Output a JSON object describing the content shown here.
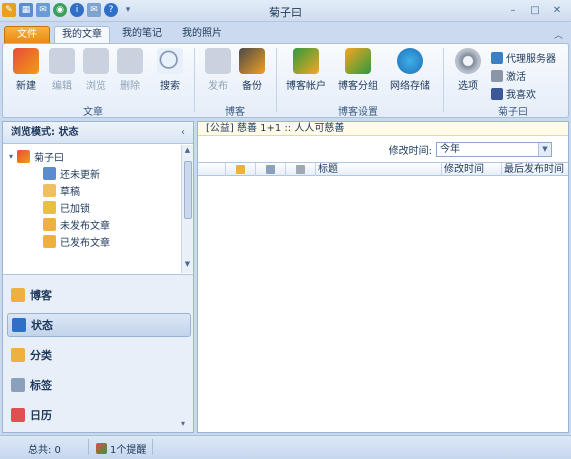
{
  "window": {
    "title": "菊子曰"
  },
  "tabs": {
    "file": "文件",
    "articles": "我的文章",
    "notes": "我的笔记",
    "photos": "我的照片"
  },
  "ribbon": {
    "new": "新建",
    "edit": "编辑",
    "browse": "浏览",
    "delete": "删除",
    "search": "搜索",
    "publish": "发布",
    "backup": "备份",
    "blog_account": "博客帐户",
    "blog_group": "博客分组",
    "net_storage": "网络存储",
    "options": "选项",
    "proxy": "代理服务器",
    "activate": "激活",
    "like": "我喜欢",
    "group_article": "文章",
    "group_blog": "博客",
    "group_blog_settings": "博客设置",
    "group_app": "菊子曰"
  },
  "left": {
    "header": "浏览模式: 状态",
    "tree": {
      "root": "菊子曰",
      "items": [
        "还未更新",
        "草稿",
        "已加锁",
        "未发布文章",
        "已发布文章"
      ]
    },
    "nav": [
      "博客",
      "状态",
      "分类",
      "标签",
      "日历"
    ]
  },
  "right": {
    "notice": "[公益] 慈善 1+1 :: 人人可慈善",
    "filter_label": "修改时间:",
    "filter_value": "今年",
    "columns": [
      "标题",
      "修改时间",
      "最后发布时间"
    ]
  },
  "status": {
    "total": "总共: 0",
    "reminder": "1个提醒"
  },
  "colors": {
    "accent": "#f0a030",
    "ribbon_blue": "#1e395b"
  }
}
